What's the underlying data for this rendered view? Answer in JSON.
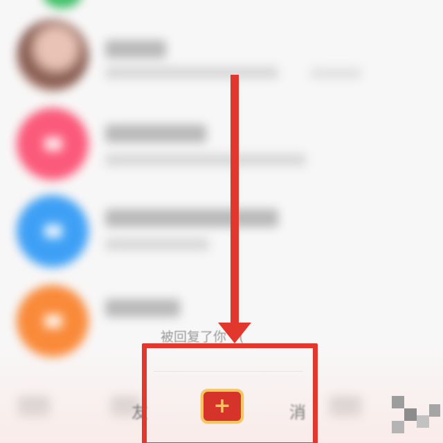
{
  "message_list": {
    "preview_text": "被回复了你 · (",
    "rows": [
      {
        "avatar": "user-photo"
      },
      {
        "avatar": "pink-heart-avatar"
      },
      {
        "avatar": "blue-service-avatar"
      },
      {
        "avatar": "orange-heart-avatar"
      }
    ]
  },
  "tab_bar": {
    "left_partial_label": "友",
    "right_partial_label": "消",
    "add_button": {
      "label": "+",
      "icon": "plus-icon"
    }
  },
  "annotation": {
    "arrow_color": "#e2372c",
    "box_color": "#e2372c"
  },
  "colors": {
    "add_button_bg": "#d6342a",
    "add_button_border": "#f6c85c"
  }
}
